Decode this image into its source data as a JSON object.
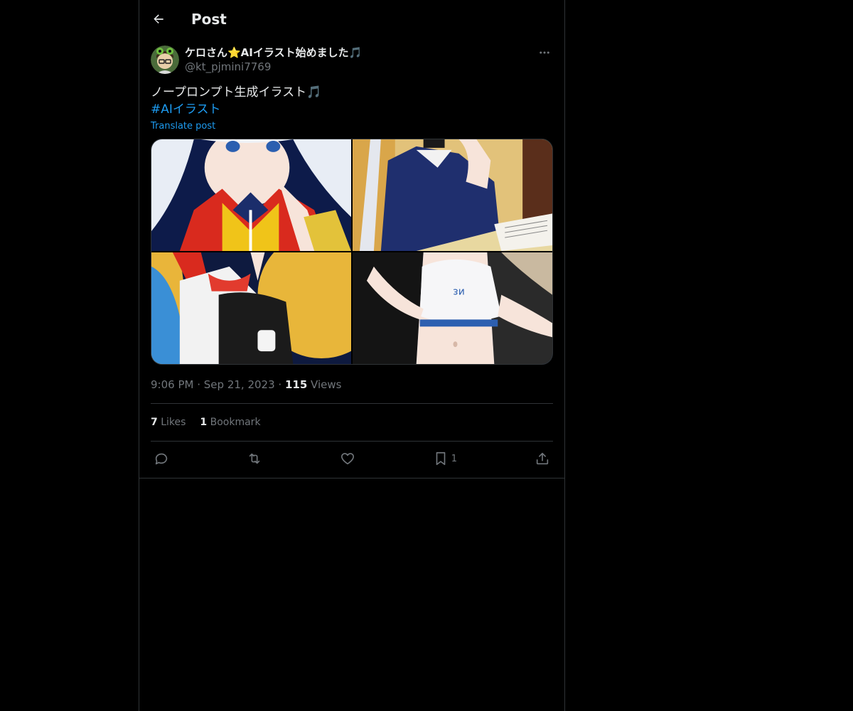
{
  "header": {
    "title": "Post"
  },
  "author": {
    "display_name": "ケロさん⭐AIイラスト始めました🎵",
    "handle": "@kt_pjmini7769"
  },
  "post": {
    "text": "ノープロンプト生成イラスト🎵",
    "hashtag": "#AIイラスト",
    "translate_label": "Translate post"
  },
  "meta": {
    "time": "9:06 PM",
    "date": "Sep 21, 2023",
    "views_count": "115",
    "views_label": "Views"
  },
  "stats": {
    "likes_count": "7",
    "likes_label": "Likes",
    "bookmarks_count": "1",
    "bookmarks_label": "Bookmark"
  },
  "actions": {
    "bookmark_count": "1"
  },
  "colors": {
    "background": "#000000",
    "link": "#1d9bf0",
    "muted": "#71767b",
    "border": "#2f3336"
  }
}
